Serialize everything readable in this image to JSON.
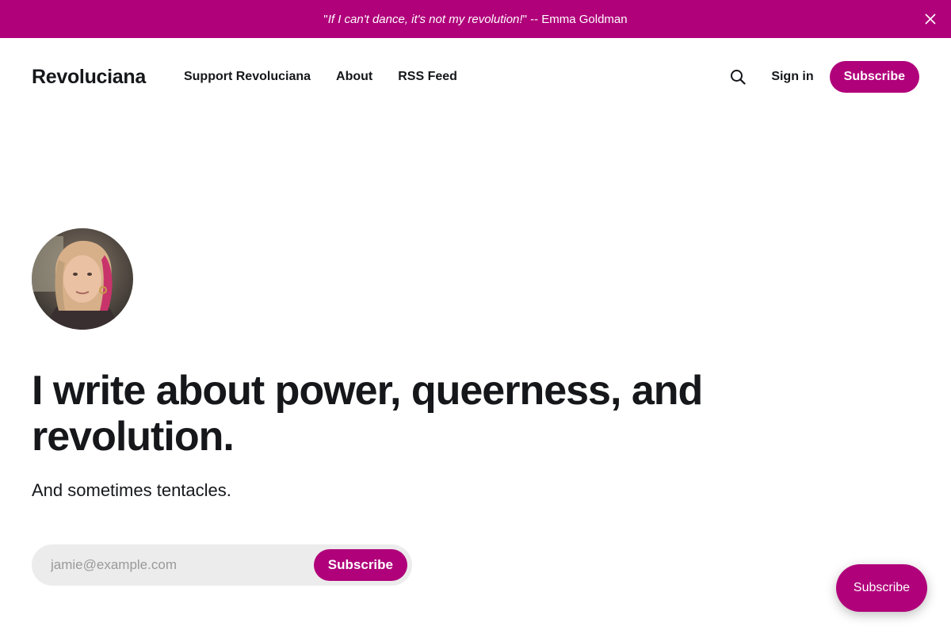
{
  "announcement": {
    "quote_open": "\"",
    "quote_text": "If I can't dance, it's not my revolution!",
    "quote_close": "\"",
    "attribution": " -- Emma Goldman",
    "close_icon": "close-icon"
  },
  "header": {
    "logo": "Revoluciana",
    "nav": [
      {
        "label": "Support Revoluciana"
      },
      {
        "label": "About"
      },
      {
        "label": "RSS Feed"
      }
    ],
    "search_icon": "search-icon",
    "signin_label": "Sign in",
    "subscribe_label": "Subscribe"
  },
  "hero": {
    "avatar": "author-avatar",
    "headline": "I write about power, queerness, and revolution.",
    "subheadline": "And sometimes tentacles.",
    "email_placeholder": "jamie@example.com",
    "subscribe_label": "Subscribe"
  },
  "floating": {
    "subscribe_label": "Subscribe"
  },
  "colors": {
    "accent": "#b0007a",
    "text": "#15171a",
    "input_bg": "#ececec"
  }
}
